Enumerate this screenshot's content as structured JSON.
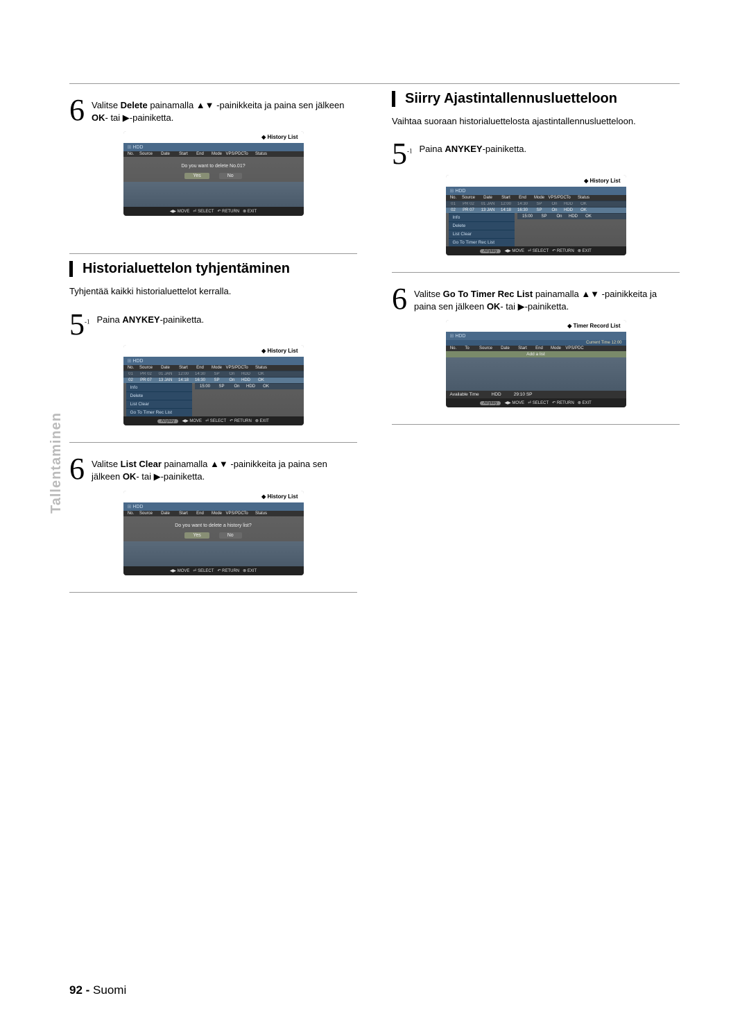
{
  "sidebar": {
    "label": "Tallentaminen"
  },
  "left": {
    "step6a": {
      "num": "6",
      "text_a": "Valitse ",
      "bold_a": "Delete",
      "text_b": " painamalla ▲▼ -painikkeita ja paina sen jälkeen ",
      "bold_b": "OK",
      "text_c": "- tai ▶-painiketta."
    },
    "section_h": "Historialuettelon tyhjentäminen",
    "body": "Tyhjentää kaikki historialuettelot kerralla.",
    "step5": {
      "num": "5",
      "sub": "-1",
      "text_a": " Paina ",
      "bold_a": "ANYKEY",
      "text_b": "-painiketta."
    },
    "step6b": {
      "num": "6",
      "text_a": "Valitse ",
      "bold_a": "List Clear",
      "text_b": " painamalla ▲▼ -painikkeita ja paina sen jälkeen ",
      "bold_b": "OK",
      "text_c": "- tai ▶-painiketta."
    }
  },
  "right": {
    "section_h": "Siirry Ajastintallennusluetteloon",
    "body": "Vaihtaa suoraan historialuettelosta ajastintallennusluetteloon.",
    "step5": {
      "num": "5",
      "sub": "-1",
      "text_a": " Paina ",
      "bold_a": "ANYKEY",
      "text_b": "-painiketta."
    },
    "step6": {
      "num": "6",
      "text_a": "Valitse ",
      "bold_a": "Go To Timer Rec List",
      "text_b": " painamalla ▲▼ -painikkeita ja paina sen jälkeen ",
      "bold_b": "OK",
      "text_c": "- tai ▶-painiketta."
    }
  },
  "osd": {
    "history_title": "History List",
    "timer_title": "Timer Record List",
    "hdd": "HDD",
    "head": [
      "No.",
      "Source",
      "Date",
      "Start",
      "End",
      "Mode",
      "VPS/PDC",
      "To",
      "Status"
    ],
    "head_t": [
      "No.",
      "To",
      "Source",
      "Date",
      "Start",
      "End",
      "Mode",
      "VPS/PDC"
    ],
    "row1": [
      "01",
      "PR 02",
      "01 JAN",
      "12:00",
      "14:30",
      "SP",
      "On",
      "HDD",
      "OK"
    ],
    "row2": [
      "02",
      "PR 07",
      "13 JAN",
      "14:18",
      "16:30",
      "SP",
      "On",
      "HDD",
      "OK"
    ],
    "row3": [
      "",
      "",
      "",
      "",
      "15:00",
      "SP",
      "On",
      "HDD",
      "OK"
    ],
    "dialog_delete": "Do you want to delete No.01?",
    "dialog_clear": "Do you want to delete a history list?",
    "yes": "Yes",
    "no": "No",
    "menu": [
      "Info",
      "Delete",
      "List Clear",
      "Go To Timer Rec List"
    ],
    "cur_time": "Current Time 12:00",
    "add": "Add a list",
    "avail_label": "Available Time",
    "avail_hdd": "HDD",
    "avail_val": "29:10 SP",
    "anykey": "Anykey",
    "foot_move": "MOVE",
    "foot_select": "SELECT",
    "foot_return": "RETURN",
    "foot_exit": "EXIT"
  },
  "page": {
    "num": "92 - ",
    "label": "Suomi"
  }
}
